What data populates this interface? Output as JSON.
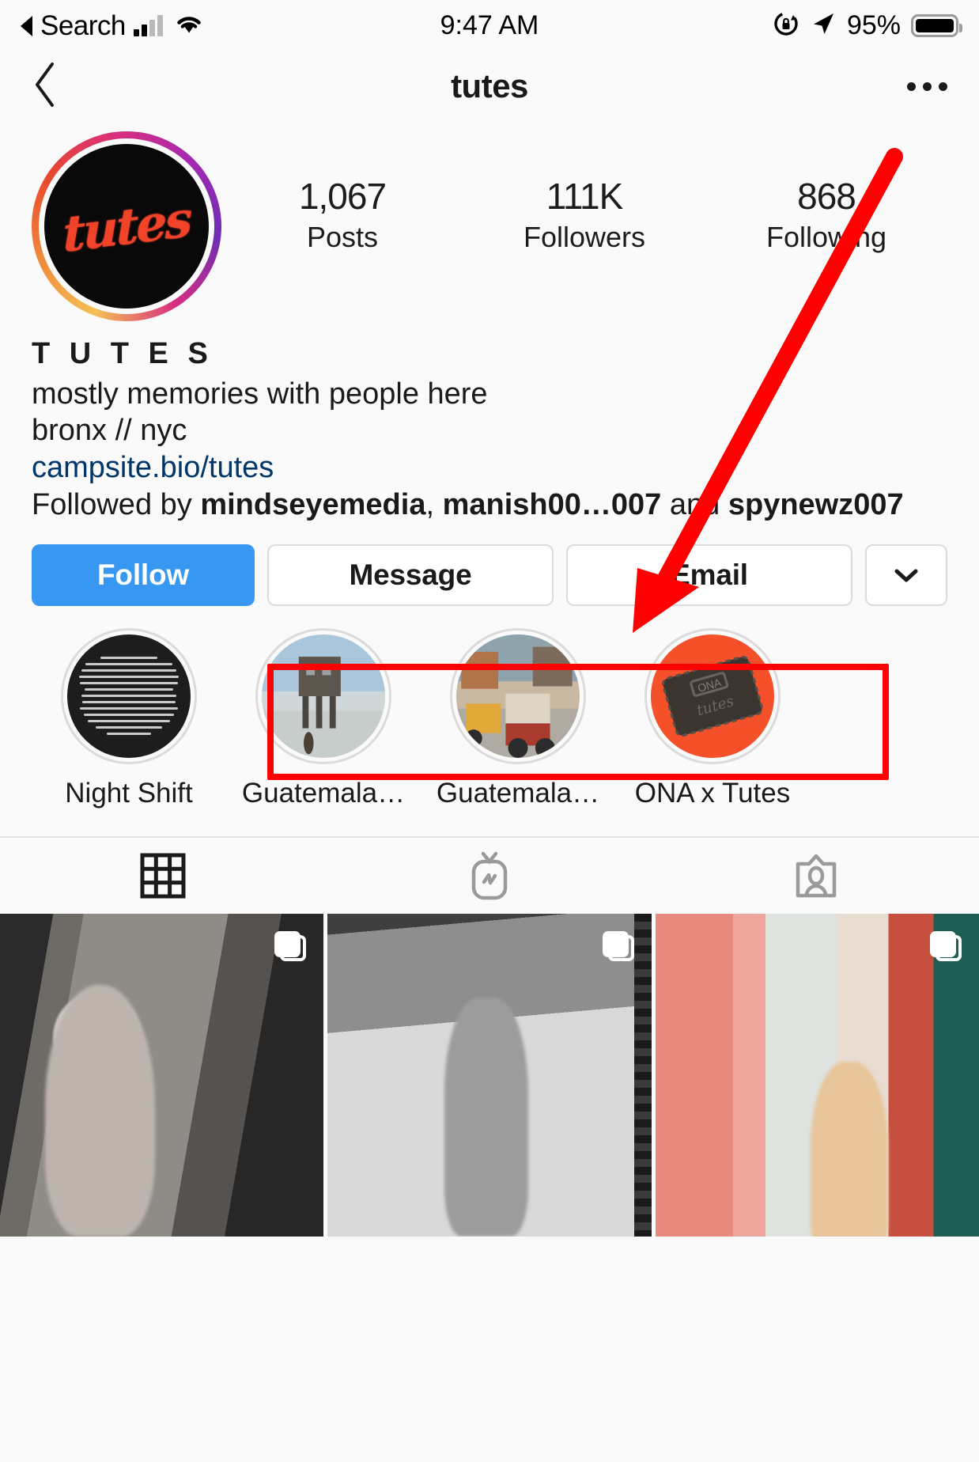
{
  "status_bar": {
    "back_label": "Search",
    "time": "9:47 AM",
    "battery_pct": "95%",
    "icons": [
      "signal-bars-icon",
      "wifi-icon",
      "rotation-lock-icon",
      "location-arrow-icon",
      "battery-icon"
    ]
  },
  "nav": {
    "title": "tutes",
    "back_icon": "chevron-left-icon",
    "more_icon": "ellipsis-icon"
  },
  "profile": {
    "avatar_logo_text": "tutes",
    "stats": [
      {
        "value": "1,067",
        "label": "Posts"
      },
      {
        "value": "111K",
        "label": "Followers"
      },
      {
        "value": "868",
        "label": "Following"
      }
    ],
    "display_name": "T U T E S",
    "bio_lines": [
      "mostly memories with people here",
      "bronx // nyc"
    ],
    "website": "campsite.bio/tutes",
    "followed_by": {
      "prefix": "Followed by ",
      "names": [
        "mindseyemedia",
        "manish00…007"
      ],
      "separator": ", ",
      "conjunction": " and ",
      "last_name": "spynewz007"
    }
  },
  "actions": {
    "follow": "Follow",
    "message": "Message",
    "email": "Email",
    "chevron_icon": "chevron-down-icon"
  },
  "highlights": [
    {
      "label": "Night Shift",
      "thumb": "night-shift-text-image"
    },
    {
      "label": "Guatemala…",
      "thumb": "guatemala-pier-image"
    },
    {
      "label": "Guatemala…",
      "thumb": "guatemala-street-image"
    },
    {
      "label": "ONA x Tutes",
      "thumb": "ona-leather-tag-image"
    }
  ],
  "tabs": [
    {
      "name": "grid-tab",
      "icon": "grid-icon",
      "active": true
    },
    {
      "name": "igtv-tab",
      "icon": "igtv-icon",
      "active": false
    },
    {
      "name": "tagged-tab",
      "icon": "tagged-person-icon",
      "active": false
    }
  ],
  "grid_posts": [
    {
      "alt": "portrait-bw-woman",
      "multi": true
    },
    {
      "alt": "bw-woman-on-bed",
      "multi": true
    },
    {
      "alt": "women-clothing-rack",
      "multi": true
    }
  ],
  "annotations": {
    "box_color": "#fe0000",
    "arrow_color": "#fe0000",
    "box_target": "message-email-dropdown-buttons",
    "arrow_target": "message-email-dropdown-buttons"
  },
  "colors": {
    "follow_blue": "#3897f0",
    "link_blue": "#00376b",
    "annotation_red": "#fe0000",
    "page_bg": "#fafafa"
  }
}
